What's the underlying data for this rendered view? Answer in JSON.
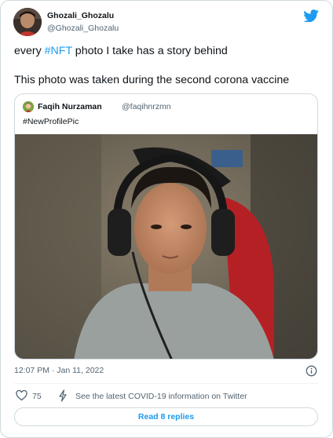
{
  "author": {
    "display_name": "Ghozali_Ghozalu",
    "handle": "@Ghozali_Ghozalu",
    "avatar_icon": "user-avatar"
  },
  "tweet": {
    "line1_before": "every ",
    "line1_hashtag": "#NFT",
    "line1_after": " photo I take has a story behind",
    "line2": "This photo was taken during the second corona vaccine",
    "timestamp": "12:07 PM · Jan 11, 2022"
  },
  "quoted": {
    "display_name": "Faqih Nurzaman",
    "handle": "@faqihnrzmn",
    "text": "#NewProfilePic",
    "photo_icon": "portrait-photo"
  },
  "actions": {
    "like_count": "75",
    "covid_text": "See the latest COVID-19 information on Twitter",
    "replies_label": "Read 8 replies"
  },
  "colors": {
    "brand": "#1d9bf0",
    "text": "#0f1419",
    "secondary": "#536471",
    "border": "#cfd9de"
  }
}
